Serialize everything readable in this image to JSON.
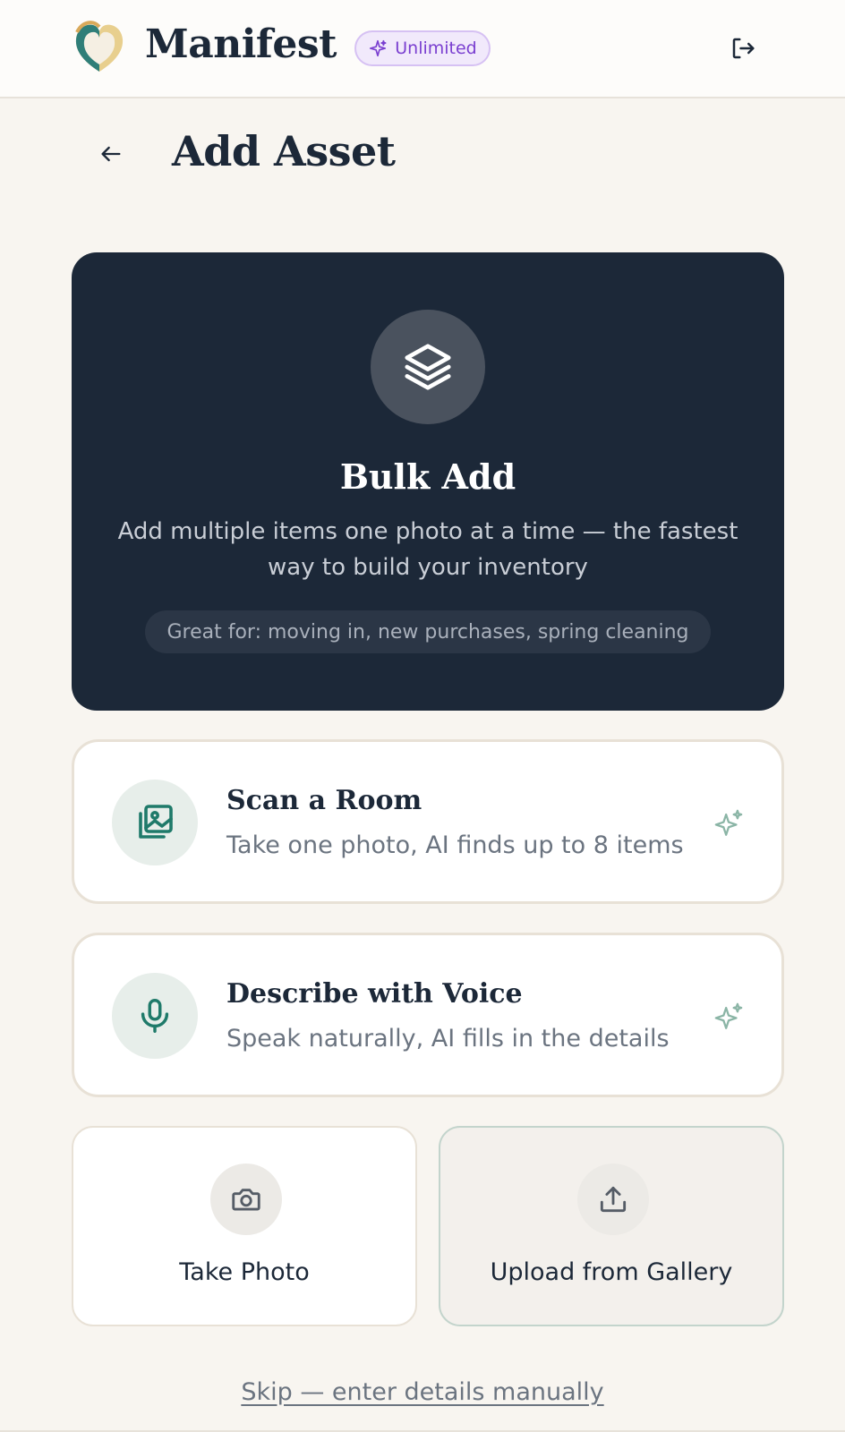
{
  "header": {
    "brand": "Manifest",
    "badge": "Unlimited",
    "logo_icon": "heart-logo-icon",
    "logout_icon": "logout-icon"
  },
  "page": {
    "title": "Add Asset",
    "back_icon": "arrow-left-icon"
  },
  "bulk": {
    "icon": "layers-icon",
    "title": "Bulk Add",
    "description": "Add multiple items one photo at a time — the fastest way to build your inventory",
    "chip": "Great for: moving in, new purchases, spring cleaning"
  },
  "options": [
    {
      "icon": "image-gallery-icon",
      "title": "Scan a Room",
      "subtitle": "Take one photo, AI finds up to 8 items",
      "badge_icon": "sparkle-icon"
    },
    {
      "icon": "microphone-icon",
      "title": "Describe with Voice",
      "subtitle": "Speak naturally, AI fills in the details",
      "badge_icon": "sparkle-icon"
    }
  ],
  "tiles": [
    {
      "icon": "camera-icon",
      "label": "Take Photo"
    },
    {
      "icon": "upload-icon",
      "label": "Upload from Gallery"
    }
  ],
  "skip_link": "Skip — enter details manually",
  "colors": {
    "navy": "#1c2838",
    "accent_teal": "#1f7a6a",
    "badge_purple": "#7a3fd0",
    "background": "#f8f5f0"
  }
}
